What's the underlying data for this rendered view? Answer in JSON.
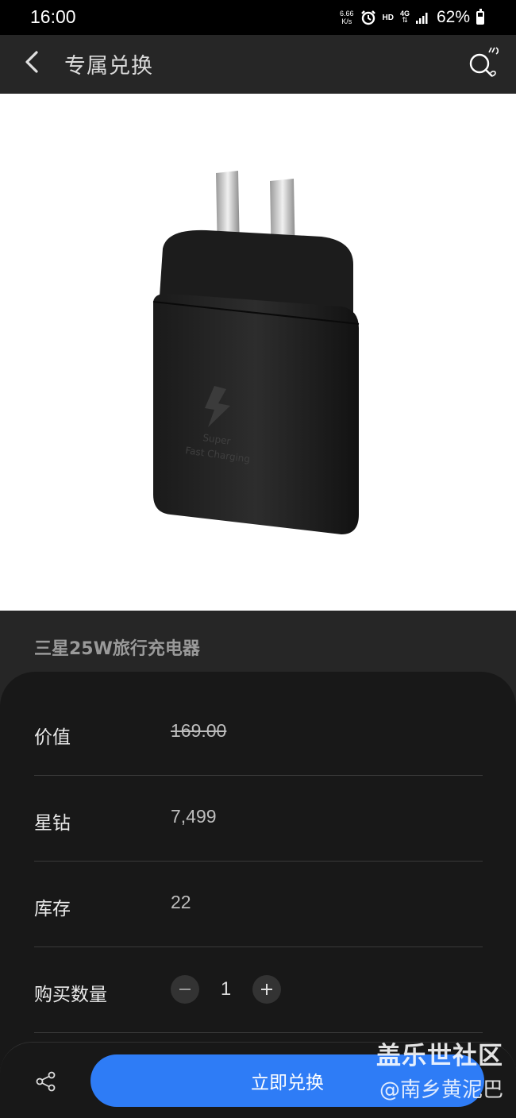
{
  "status_bar": {
    "time": "16:00",
    "net_speed_value": "6.66",
    "net_speed_unit": "K/s",
    "hd": "HD",
    "network": "4G",
    "battery_percent": "62%",
    "icons": [
      "alarm-icon",
      "signal-icon",
      "battery-icon"
    ]
  },
  "header": {
    "title": "专属兑换",
    "back_icon": "chevron-left-icon",
    "scan_icon": "search-scan-icon"
  },
  "product": {
    "name": "三星25W旅行充电器",
    "image_text_line1": "Super",
    "image_text_line2": "Fast Charging"
  },
  "details": {
    "value_label": "价值",
    "value": "169.00",
    "stars_label": "星钻",
    "stars": "7,499",
    "stock_label": "库存",
    "stock": "22",
    "quantity_label": "购买数量",
    "quantity": "1"
  },
  "bottom_bar": {
    "cta_label": "立即兑换",
    "share_icon": "share-icon"
  },
  "watermark": {
    "line1": "盖乐世社区",
    "line2": "@南乡黄泥巴"
  },
  "colors": {
    "accent": "#2e7cf6",
    "background": "#262626",
    "card": "#181818"
  }
}
